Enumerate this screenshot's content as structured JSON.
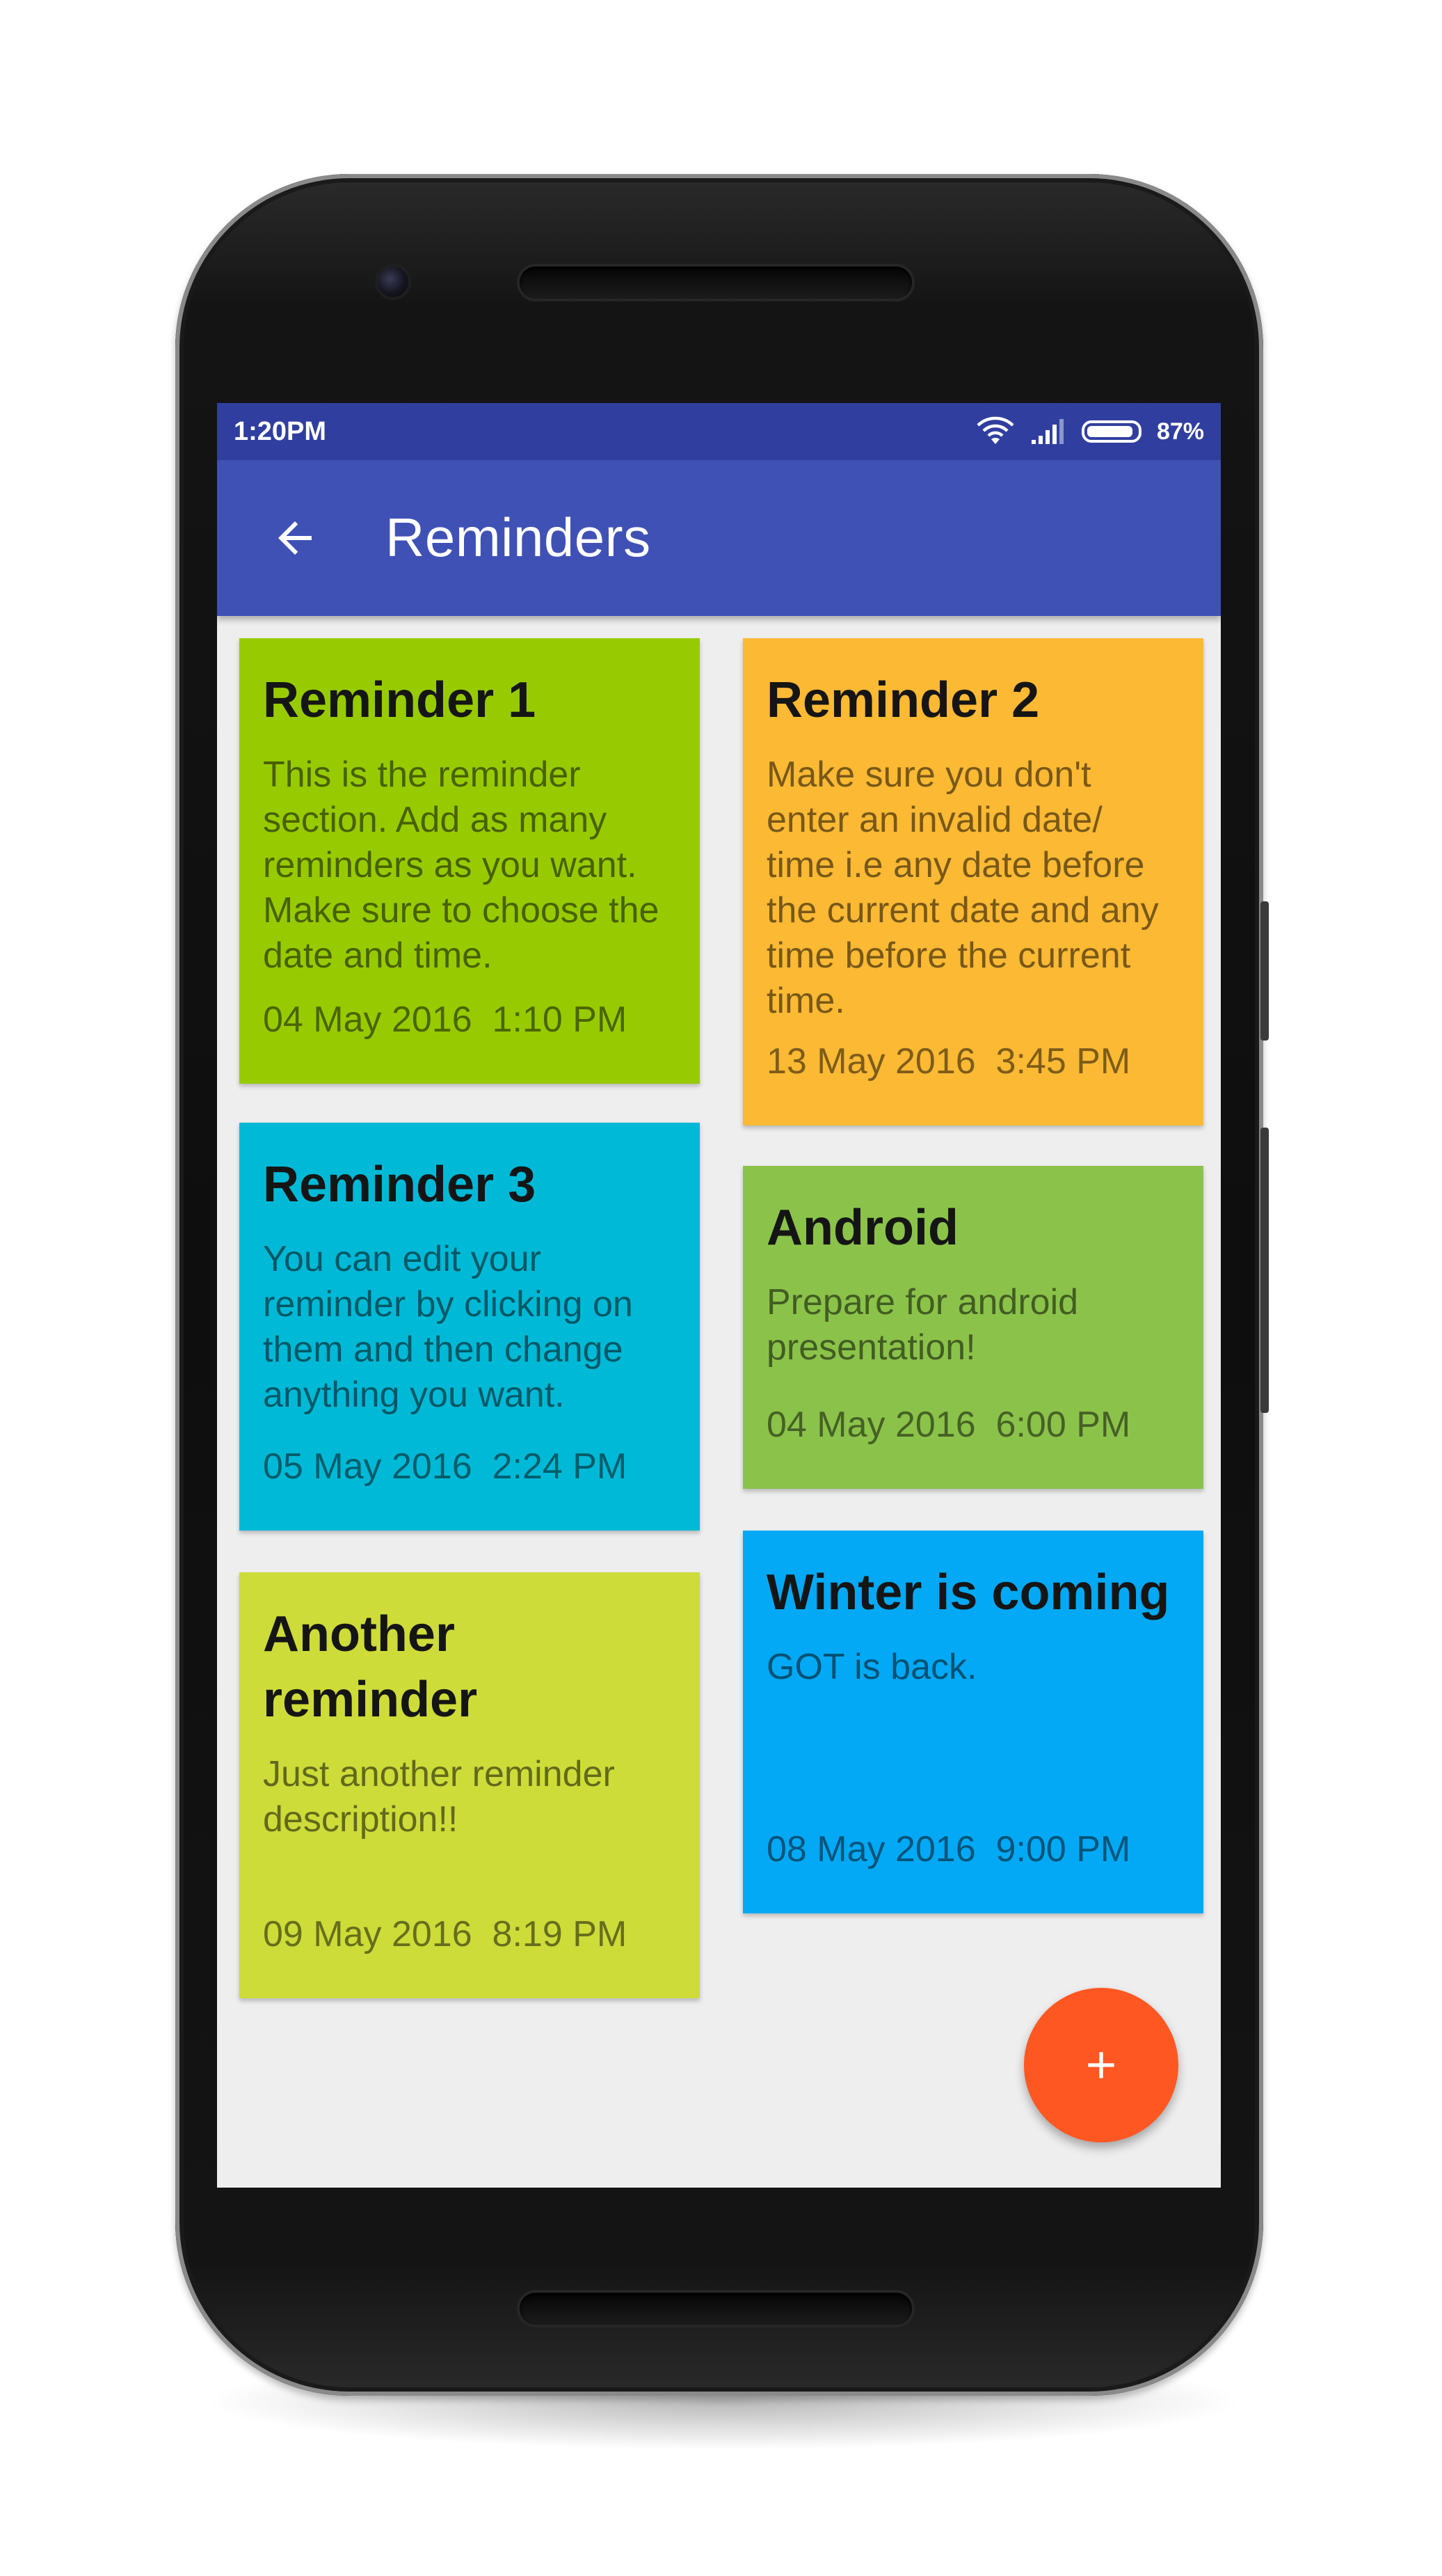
{
  "status_bar": {
    "time": "1:20PM",
    "battery_percent": "87%",
    "icons": [
      "wifi-icon",
      "signal-icon",
      "battery-icon"
    ]
  },
  "app_bar": {
    "title": "Reminders",
    "back_icon": "arrow-left-icon"
  },
  "reminders": [
    {
      "title": "Reminder 1",
      "description": "This is the reminder section. Add as many reminders as you want. Make sure to choose the date and time.",
      "date": "04 May 2016  1:10 PM",
      "color": "#97cb00"
    },
    {
      "title": "Reminder 2",
      "description": "Make sure you don't enter an invalid date/ time i.e any date before the current date and any time before the current time.",
      "date": "13 May 2016  3:45 PM",
      "color": "#fbb934"
    },
    {
      "title": "Reminder 3",
      "description": "You can edit your reminder by clicking on them and then change anything you want.",
      "date": "05 May 2016  2:24 PM",
      "color": "#00b9d6"
    },
    {
      "title": "Android",
      "description": "Prepare for android presentation!",
      "date": "04 May 2016  6:00 PM",
      "color": "#8bc34a"
    },
    {
      "title": "Another reminder",
      "description": "Just another reminder description!!",
      "date": "09 May 2016  8:19 PM",
      "color": "#cddc39"
    },
    {
      "title": "Winter is coming",
      "description": "GOT is back.",
      "date": "08 May 2016  9:00 PM",
      "color": "#03a9f4"
    }
  ],
  "fab": {
    "icon": "plus-icon",
    "color": "#ff5722"
  }
}
